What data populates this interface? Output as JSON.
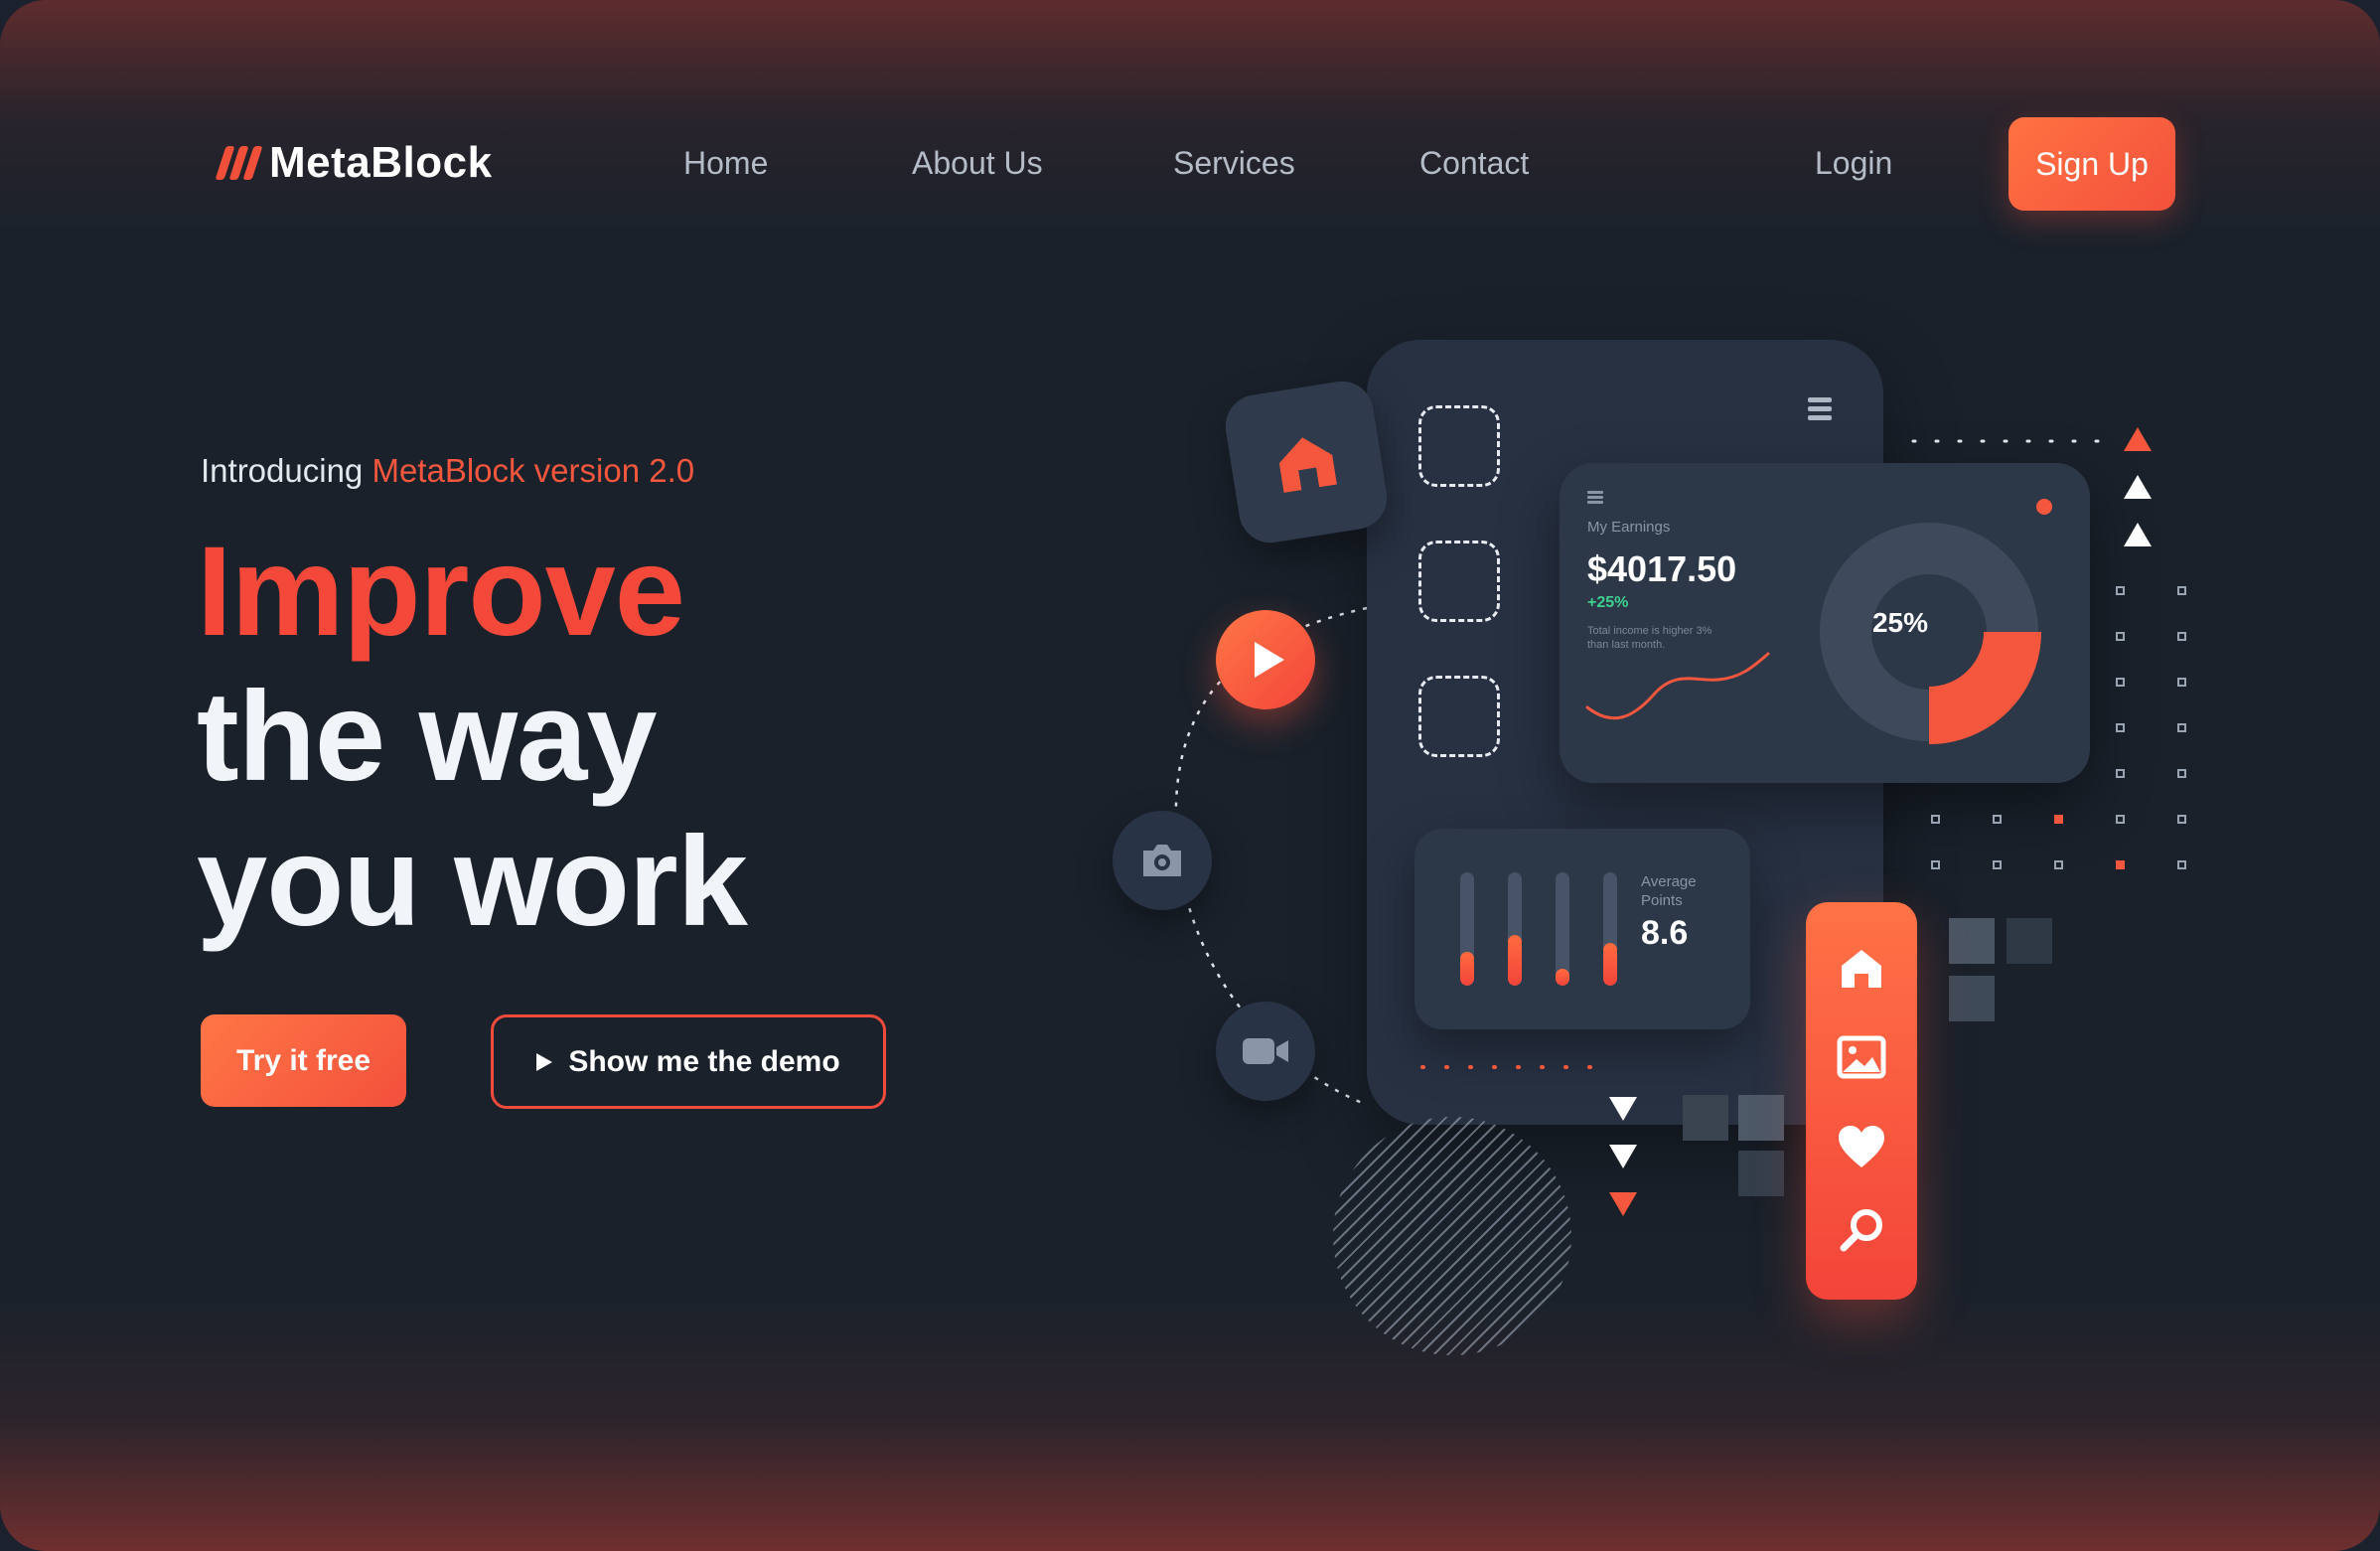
{
  "brand": {
    "name": "MetaBlock"
  },
  "nav": {
    "links": [
      "Home",
      "About Us",
      "Services",
      "Contact"
    ],
    "login": "Login",
    "signup": "Sign Up"
  },
  "hero": {
    "intro_prefix": "Introducing",
    "intro_highlight": "MetaBlock version 2.0",
    "headline": [
      "Improve",
      "the way",
      "you work"
    ],
    "cta_primary": "Try it free",
    "cta_secondary": "Show me the demo"
  },
  "earnings_card": {
    "label": "My Earnings",
    "amount": "$4017.50",
    "change": "+25%",
    "note": "Total income is higher 3% than last month.",
    "donut_percent": "25%",
    "donut_fraction": 0.25
  },
  "points_card": {
    "label_line1": "Average",
    "label_line2": "Points",
    "value": "8.6",
    "bar_levels": [
      0.3,
      0.45,
      0.15,
      0.38
    ]
  },
  "side_icons": [
    "home-icon",
    "image-icon",
    "heart-icon",
    "search-icon"
  ],
  "colors": {
    "accent": "#f4493a",
    "accent_gradient_start": "#ff7646",
    "background": "#1a212b",
    "card": "#2c3748",
    "positive": "#3fcf8e"
  }
}
